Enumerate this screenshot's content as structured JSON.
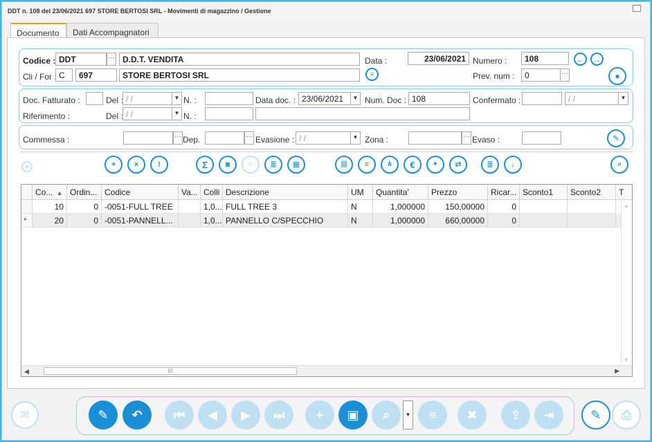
{
  "window": {
    "title": "DDT n. 108 del 23/06/2021 697 STORE BERTOSI SRL - Movimenti di magazzino / Gestione"
  },
  "tabs": [
    {
      "label": "Documento",
      "active": true
    },
    {
      "label": "Dati Accompagnatori",
      "active": false
    }
  ],
  "header": {
    "codice_label": "Codice :",
    "codice_value": "DDT",
    "codice_desc": "D.D.T. VENDITA",
    "data_label": "Data :",
    "data_value": "23/06/2021",
    "numero_label": "Numero :",
    "numero_value": "108",
    "clifor_label": "Cli / For :",
    "clifor_type": "C",
    "clifor_code": "697",
    "clifor_name": "STORE BERTOSI SRL",
    "prevnum_label": "Prev. num :",
    "prevnum_value": "0"
  },
  "doc": {
    "fatturato_label": "Doc. Fatturato :",
    "del_label": "Del :",
    "del_value": "/ /",
    "n_label": "N. :",
    "data_doc_label": "Data doc. :",
    "data_doc_value": "23/06/2021",
    "num_doc_label": "Num. Doc :",
    "num_doc_value": "108",
    "confermato_label": "Confermato :",
    "confermato_date": "/ /",
    "riferimento_label": "Riferimento :",
    "del2_label": "Del :",
    "del2_value": "/ /",
    "n2_label": "N. :"
  },
  "commessa": {
    "commessa_label": "Commessa :",
    "dep_label": "Dep.",
    "evasione_label": "Evasione :",
    "evasione_value": "/ /",
    "zona_label": "Zona :",
    "evaso_label": "Evaso :"
  },
  "grid": {
    "columns": [
      "Co...",
      "Ordin...",
      "Codice",
      "Va...",
      "Colli",
      "Descrizione",
      "UM",
      "Quantita'",
      "Prezzo",
      "Ricar...",
      "Sconto1",
      "Sconto2",
      "T"
    ],
    "rows": [
      {
        "co": "10",
        "ordine": "0",
        "codice": "-0051-FULL TREE",
        "va": "",
        "colli": "1,0...",
        "descrizione": "FULL TREE 3",
        "um": "N",
        "quantita": "1,000000",
        "prezzo": "150,00000",
        "ricarico": "0"
      },
      {
        "co": "20",
        "ordine": "0",
        "codice": "-0051-PANNELL...",
        "va": "",
        "colli": "1,0...",
        "descrizione": "PANNELLO C/SPECCHIO",
        "um": "N",
        "quantita": "1,000000",
        "prezzo": "660,00000",
        "ricarico": "0"
      }
    ]
  },
  "icons": {
    "sort_indicator": "▲",
    "scroll_grip": "III",
    "row_pointer": "▸"
  },
  "colors": {
    "accent": "#1a8fd6",
    "accent_faint": "#bfe0f3",
    "tab_active": "#f39c12"
  }
}
